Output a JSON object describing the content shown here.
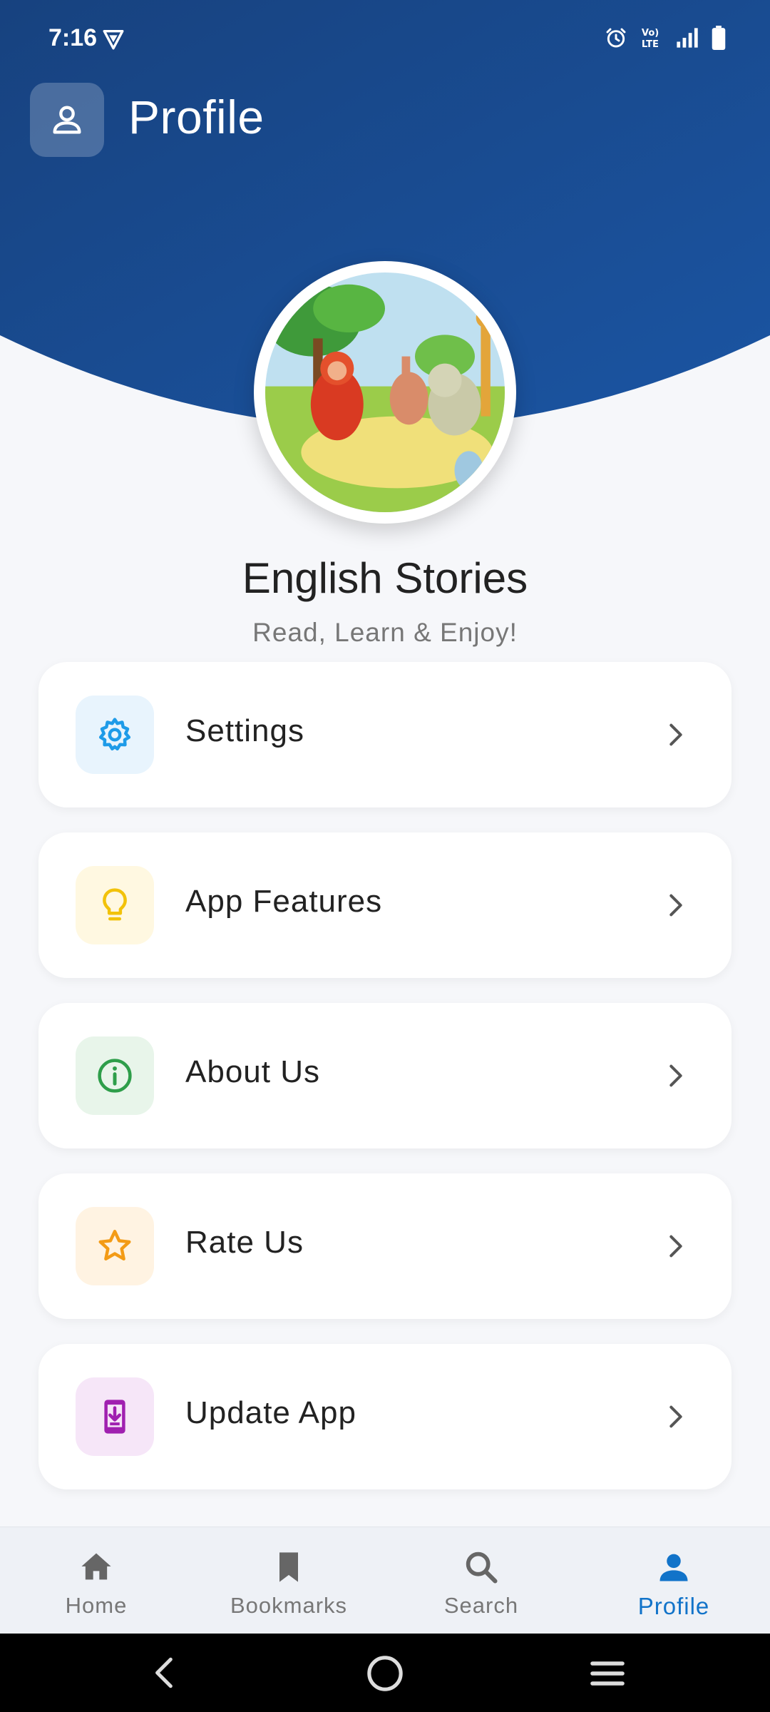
{
  "status_bar": {
    "time": "7:16"
  },
  "header": {
    "title": "Profile"
  },
  "profile": {
    "app_name": "English Stories",
    "tagline": "Read, Learn & Enjoy!"
  },
  "menu": [
    {
      "label": "Settings",
      "icon": "gear-icon",
      "color": "#1e9be8",
      "bg": "#e8f4fd"
    },
    {
      "label": "App Features",
      "icon": "lightbulb-icon",
      "color": "#f2c20a",
      "bg": "#fff8e1"
    },
    {
      "label": "About Us",
      "icon": "info-icon",
      "color": "#2e9e4a",
      "bg": "#e8f5ea"
    },
    {
      "label": "Rate Us",
      "icon": "star-icon",
      "color": "#f39b16",
      "bg": "#fff3e2"
    },
    {
      "label": "Update App",
      "icon": "download-phone-icon",
      "color": "#a020b0",
      "bg": "#f6e6f8"
    }
  ],
  "bottom_nav": [
    {
      "label": "Home",
      "icon": "home-icon"
    },
    {
      "label": "Bookmarks",
      "icon": "bookmark-icon"
    },
    {
      "label": "Search",
      "icon": "search-icon"
    },
    {
      "label": "Profile",
      "icon": "person-icon",
      "active": true
    }
  ],
  "colors": {
    "header": "#1a4d96",
    "accent": "#1173c9"
  }
}
